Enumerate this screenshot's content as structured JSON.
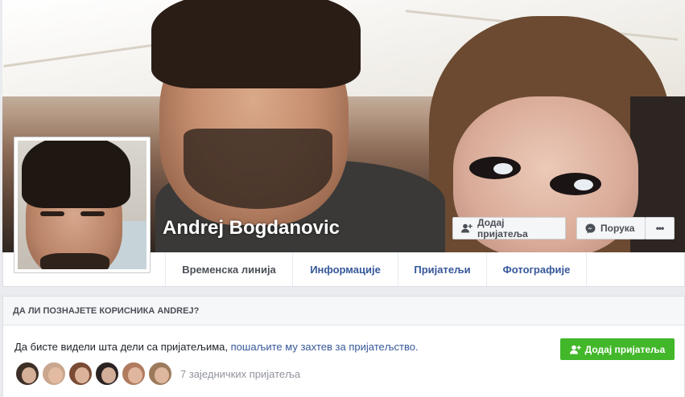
{
  "profile": {
    "name": "Andrej Bogdanovic"
  },
  "cover_actions": {
    "add_friend_label": "Додај пријатеља",
    "message_label": "Порука",
    "more_label": "•••"
  },
  "tabs": [
    {
      "label": "Временска линија",
      "active": true
    },
    {
      "label": "Информације",
      "active": false
    },
    {
      "label": "Пријатељи",
      "active": false
    },
    {
      "label": "Фотографије",
      "active": false
    }
  ],
  "know_card": {
    "title": "ДА ЛИ ПОЗНАЈЕТЕ КОРИСНИКА ANDREJ?",
    "text_prefix": "Да бисте видели шта дели са пријатељима,",
    "text_link": "пошаљите му захтев за пријатељство.",
    "add_friend_label": "Додај пријатеља",
    "mutual_friends_text": "7 заједничких пријатеља",
    "mutual_avatar_colors": [
      "#3d2f26",
      "#c9a68d",
      "#7a4a34",
      "#2b2222",
      "#b07b5f",
      "#9d7a5c"
    ]
  },
  "colors": {
    "link": "#365899",
    "green": "#42b72a",
    "background": "#e9ebee"
  },
  "icons": {
    "add_friend": "person-plus-icon",
    "message": "messenger-icon"
  }
}
